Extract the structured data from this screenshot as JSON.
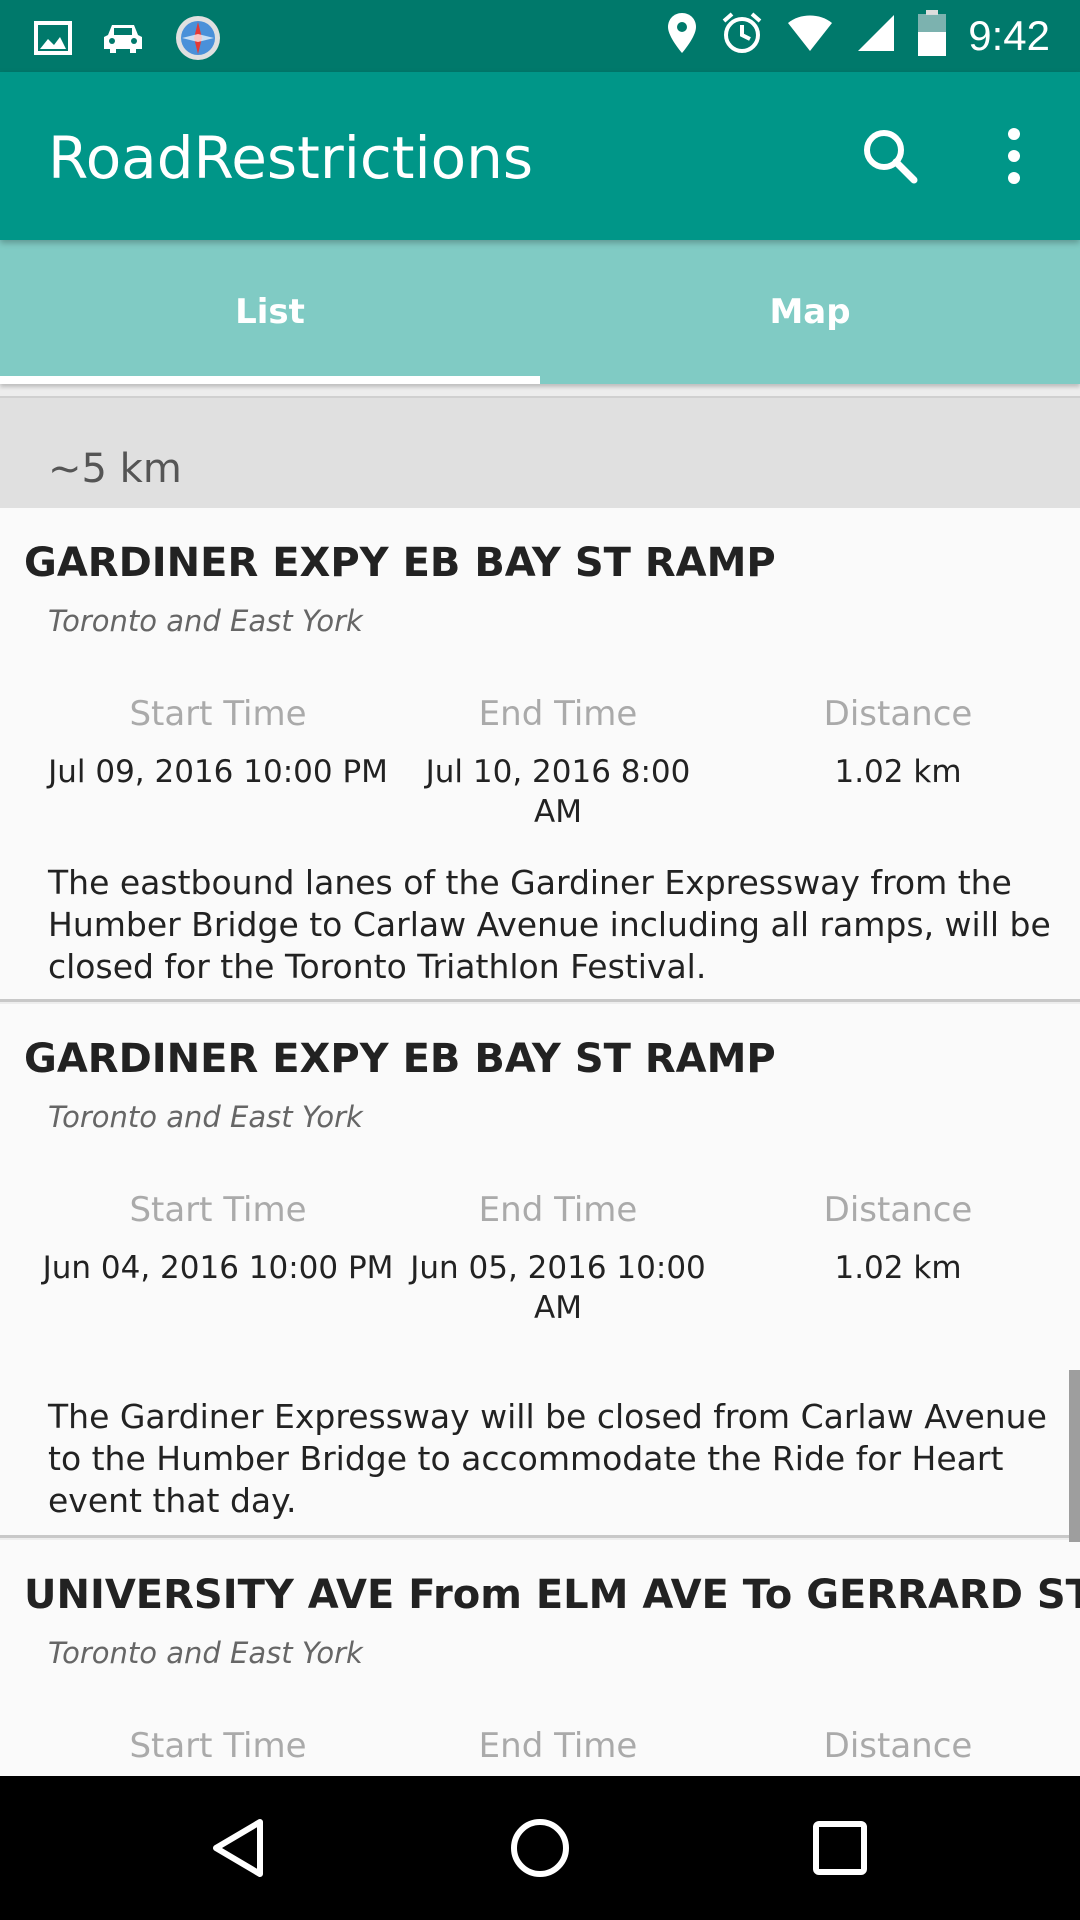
{
  "status_bar": {
    "time": "9:42",
    "left_icons": [
      "image-icon",
      "car-icon",
      "compass-icon"
    ],
    "right_icons": [
      "location-pin-icon",
      "alarm-icon",
      "wifi-icon",
      "signal-icon",
      "battery-icon"
    ]
  },
  "app_bar": {
    "title": "RoadRestrictions",
    "color": "#009688"
  },
  "tabs": [
    {
      "label": "List",
      "selected": true
    },
    {
      "label": "Map",
      "selected": false
    }
  ],
  "section": {
    "label": "~5 km"
  },
  "column_headers": {
    "start": "Start Time",
    "end": "End Time",
    "distance": "Distance"
  },
  "restrictions": [
    {
      "title": "GARDINER EXPY EB BAY ST RAMP",
      "area": "Toronto and East York",
      "start_time": "Jul 09, 2016 10:00 PM",
      "end_time": "Jul 10, 2016 8:00 AM",
      "distance": "1.02 km",
      "description": "The eastbound lanes of the Gardiner Expressway from the Humber Bridge to Carlaw Avenue including all ramps, will be closed for the Toronto Triathlon Festival."
    },
    {
      "title": "GARDINER EXPY EB BAY ST RAMP",
      "area": "Toronto and East York",
      "start_time": "Jun 04, 2016 10:00 PM",
      "end_time": "Jun 05, 2016 10:00 AM",
      "distance": "1.02 km",
      "description": "The Gardiner Expressway will be closed from Carlaw Avenue to the Humber Bridge to accommodate the Ride for Heart event that day."
    },
    {
      "title": "UNIVERSITY AVE From ELM AVE To GERRARD ST W",
      "area": "Toronto and East York"
    }
  ]
}
